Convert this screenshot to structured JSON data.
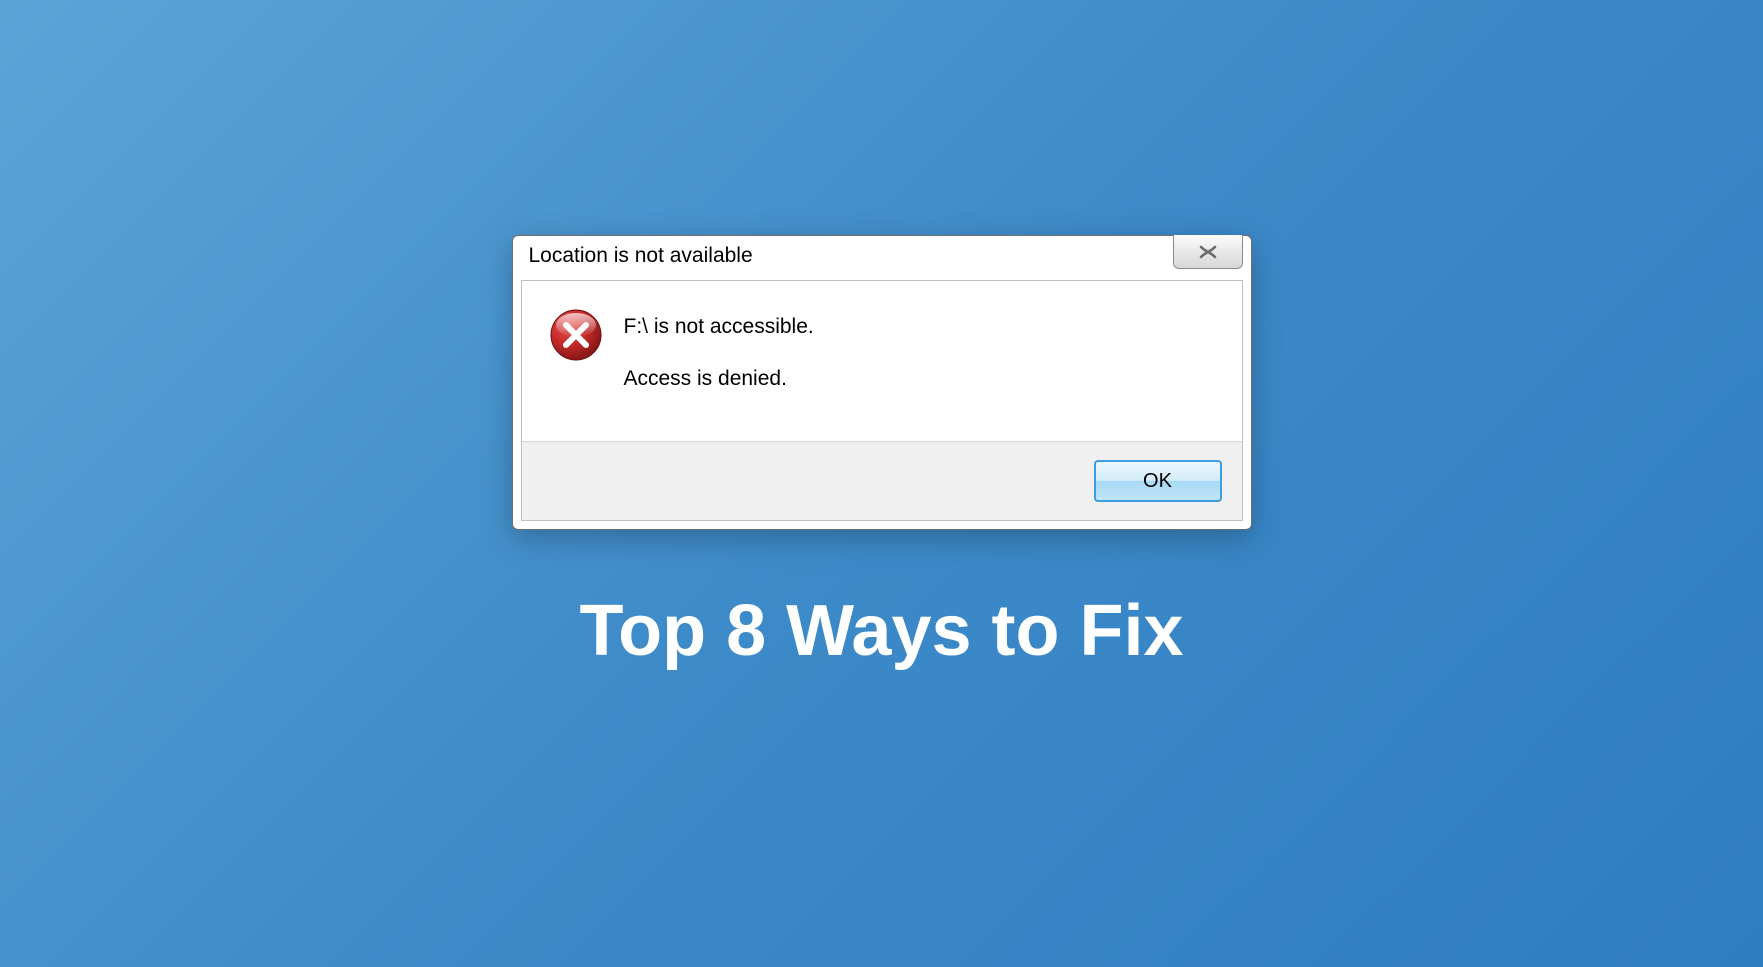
{
  "dialog": {
    "title": "Location is not available",
    "close_label": "✕",
    "message_line1": "F:\\ is not accessible.",
    "message_line2": "Access is denied.",
    "ok_label": "OK",
    "icon_name": "error-icon"
  },
  "headline": "Top 8 Ways to Fix",
  "colors": {
    "background_start": "#5ba4d8",
    "background_end": "#2e7dc0",
    "button_border": "#3c9de0",
    "error_red": "#b02020"
  }
}
